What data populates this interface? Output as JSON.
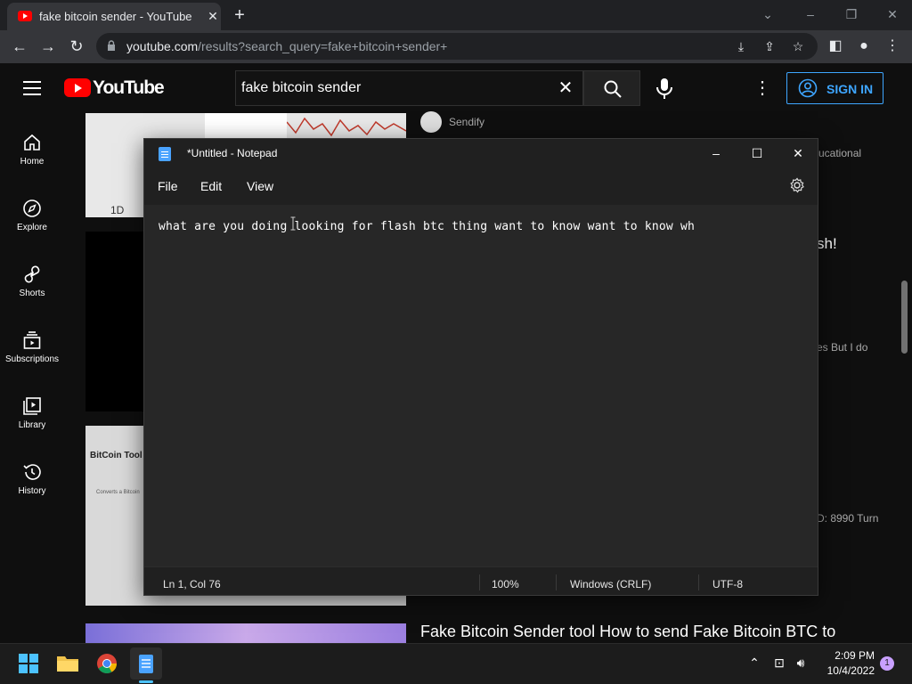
{
  "browser": {
    "tab_title": "fake bitcoin sender - YouTube",
    "url_host": "youtube.com",
    "url_path": "/results?search_query=fake+bitcoin+sender+"
  },
  "youtube": {
    "logo_text": "YouTube",
    "search_value": "fake bitcoin sender",
    "sign_in_label": "SIGN IN",
    "nav": [
      {
        "label": "Home",
        "icon": "home-icon"
      },
      {
        "label": "Explore",
        "icon": "compass-icon"
      },
      {
        "label": "Shorts",
        "icon": "shorts-icon"
      },
      {
        "label": "Subscriptions",
        "icon": "subscriptions-icon"
      },
      {
        "label": "Library",
        "icon": "library-icon"
      },
      {
        "label": "History",
        "icon": "history-icon"
      }
    ],
    "results": {
      "channel_name": "Sendify",
      "frag_1": "ucational",
      "frag_2": "sh!",
      "frag_3": "es But I do",
      "frag_4": "D: 8990 Turn",
      "thumb1_label": "1D",
      "thumb3_title": "BitCoin Tool",
      "thumb3_line1": "Converts a Bitcoin",
      "last_title": "Fake Bitcoin Sender tool How to send Fake Bitcoin BTC to"
    }
  },
  "notepad": {
    "title": "*Untitled - Notepad",
    "menu": [
      "File",
      "Edit",
      "View"
    ],
    "content": "what are you doing looking for flash btc thing want to know want to know wh",
    "status": {
      "position": "Ln 1, Col 76",
      "zoom": "100%",
      "line_ending": "Windows (CRLF)",
      "encoding": "UTF-8"
    }
  },
  "taskbar": {
    "time": "2:09 PM",
    "date": "10/4/2022",
    "notification_count": "1"
  },
  "colors": {
    "youtube_red": "#ff0000",
    "signin_blue": "#3ea6ff",
    "chrome_toolbar": "#35363a",
    "notepad_bg": "#272727"
  }
}
